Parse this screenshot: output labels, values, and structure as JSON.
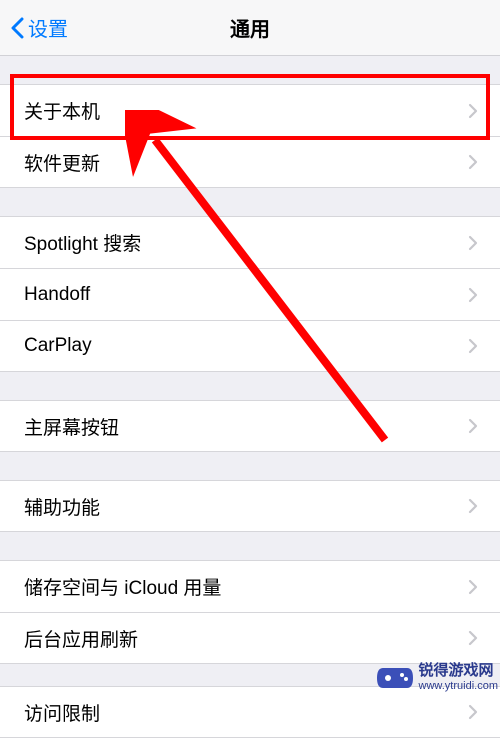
{
  "header": {
    "back_label": "设置",
    "title": "通用"
  },
  "rows": {
    "about": "关于本机",
    "software_update": "软件更新",
    "spotlight": "Spotlight 搜索",
    "handoff": "Handoff",
    "carplay": "CarPlay",
    "home_button": "主屏幕按钮",
    "accessibility": "辅助功能",
    "storage": "储存空间与 iCloud 用量",
    "background_refresh": "后台应用刷新",
    "restrictions": "访问限制"
  },
  "watermark": {
    "cn": "锐得游戏网",
    "url": "www.ytruidi.com"
  }
}
